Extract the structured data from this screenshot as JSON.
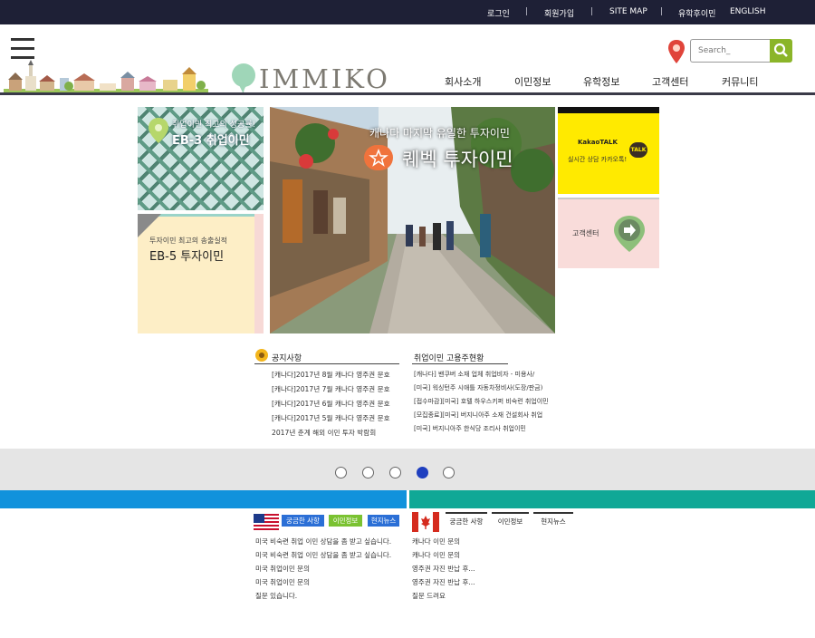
{
  "topbar": {
    "login": "로그인",
    "signup": "회원가입",
    "sitemap": "SITE MAP",
    "after_study": "유학후이민",
    "english": "ENGLISH",
    "separator": "|"
  },
  "header": {
    "logo_text": "IMMIKO",
    "search_placeholder": "Search_",
    "nav": [
      "회사소개",
      "이민정보",
      "유학정보",
      "고객센터",
      "커뮤니티"
    ]
  },
  "promos": {
    "eb3": {
      "subtitle": "취업이민 최고의 성공률!",
      "title": "EB-3 취업이민"
    },
    "eb5": {
      "subtitle": "투자이민 최고의 송출실적",
      "title": "EB-5 투자이민"
    },
    "hero": {
      "subtitle": "캐나다 마지막 유일한 투자이민",
      "title": "퀘벡 투자이민"
    },
    "kakao": {
      "brand": "KakaoTALK",
      "text": "실시간 상담 카카오톡!",
      "badge": "TALK"
    },
    "cs": {
      "label": "고객센터"
    }
  },
  "notices": {
    "title": "공지사항",
    "items": [
      "[캐나다]2017년 8월 캐나다 영주권 문호",
      "[캐나다]2017년 7월 캐나다 영주권 문호",
      "[캐나다]2017년 6월 캐나다 영주권 문호",
      "[캐나다]2017년 5월 캐나다 영주권 문호",
      "2017년 춘계 해외 이민 투자 박람회"
    ]
  },
  "employment": {
    "title": "취업이민 고용주현황",
    "items": [
      "[캐나다] 밴쿠버 소재 업체 취업비자 - 미용사/",
      "[미국] 워싱턴주 시애틀 자동차정비사(도장/판금)",
      "[접수마감][미국] 호텔 하우스키퍼 비숙련 취업이민",
      "[모집종료][미국] 버지니아주 소재 건설회사 취업",
      "[미국] 버지니아주 한식당 조리사 취업이민"
    ]
  },
  "slider": {
    "count": 5,
    "active_index": 3
  },
  "usa": {
    "tabs": [
      "궁금한 사항",
      "이민정보",
      "현지뉴스"
    ],
    "items": [
      "미국 비숙련 취업 이민 상담을 좀 받고 싶습니다.",
      "미국 비숙련 취업 이민 상담을 좀 받고 싶습니다.",
      "미국 취업이민 문의",
      "미국 취업이민 문의",
      "질문 있습니다."
    ]
  },
  "canada": {
    "tabs": [
      "궁금한 사항",
      "이민정보",
      "현지뉴스"
    ],
    "items": [
      "캐나다 이민 문의",
      "캐나다 이민 문의",
      "영주권 자진 반납 후...",
      "영주권 자진 반납 후...",
      "질문 드려요"
    ]
  },
  "colors": {
    "topbar": "#1e2036",
    "search_button": "#8bb529",
    "usa_bar": "#1192dc",
    "canada_bar": "#10a896",
    "kakao": "#ffea00",
    "active_dot": "#1f3fbf"
  }
}
